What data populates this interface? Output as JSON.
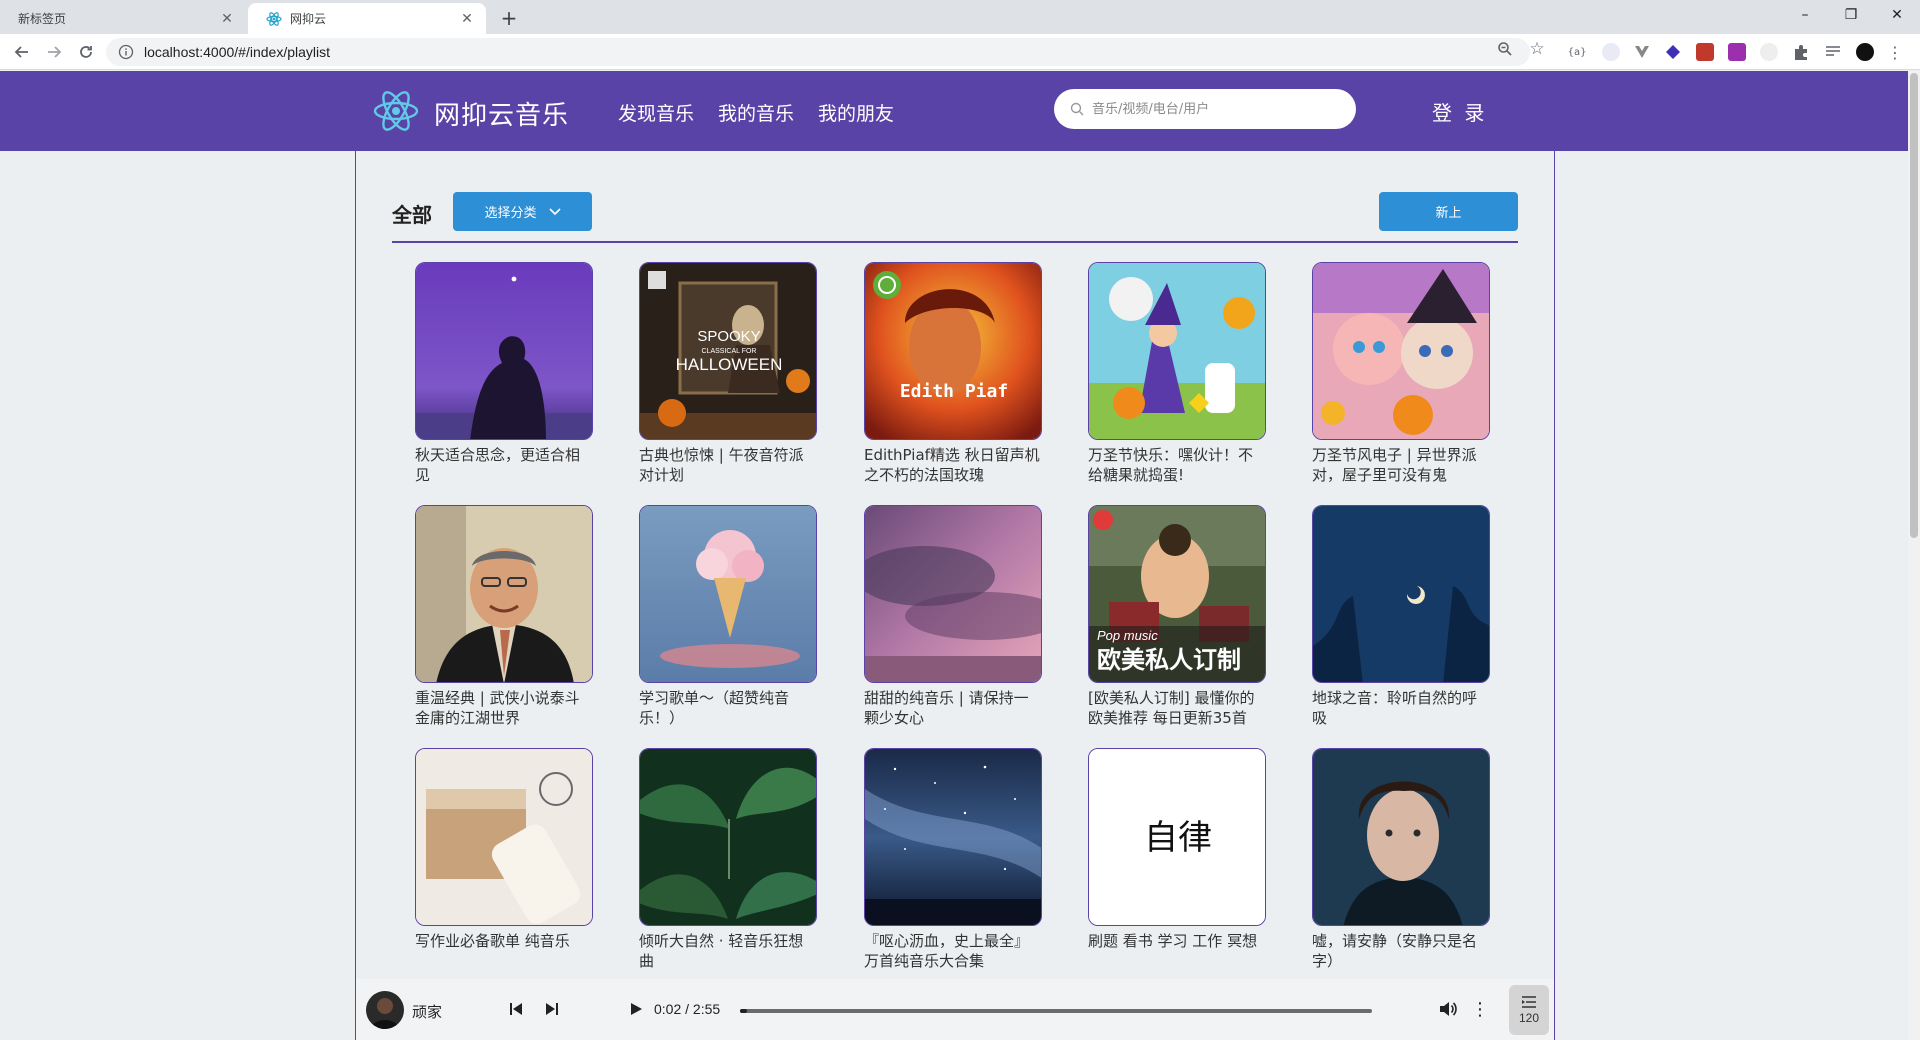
{
  "browser": {
    "tabs": [
      {
        "label": "新标签页",
        "active": false
      },
      {
        "label": "网抑云",
        "active": true
      }
    ],
    "url": "localhost:4000/#/index/playlist"
  },
  "header": {
    "logo_text": "网抑云音乐",
    "nav": [
      "发现音乐",
      "我的音乐",
      "我的朋友"
    ],
    "search_placeholder": "音乐/视频/电台/用户",
    "login_label": "登 录",
    "colors": {
      "brand": "#5a43a6",
      "accent": "#2d8fd5"
    }
  },
  "category": {
    "title": "全部",
    "select_label": "选择分类",
    "new_label": "新上"
  },
  "playlists": [
    {
      "title": "秋天适合思念，更适合相见",
      "cover": "purple-night-hoodie"
    },
    {
      "title": "古典也惊悚 | 午夜音符派对计划",
      "cover": "spooky-classical-halloween",
      "cover_text": [
        "SPOOKY",
        "CLASSICAL FOR",
        "HALLOWEEN"
      ]
    },
    {
      "title": "EdithPiaf精选 秋日留声机之不朽的法国玫瑰",
      "cover": "edith-piaf-portrait",
      "cover_text": [
        "Edith Piaf"
      ]
    },
    {
      "title": "万圣节快乐：嘿伙计！不给糖果就捣蛋!",
      "cover": "halloween-cartoon"
    },
    {
      "title": "万圣节风电子 | 异世界派对，屋子里可没有鬼",
      "cover": "anime-halloween-girls"
    },
    {
      "title": "重温经典 | 武侠小说泰斗金庸的江湖世界",
      "cover": "old-man-portrait"
    },
    {
      "title": "学习歌单～（超赞纯音乐！）",
      "cover": "cloud-ice-cream"
    },
    {
      "title": "甜甜的纯音乐 | 请保持一颗少女心",
      "cover": "pink-clouds"
    },
    {
      "title": "[欧美私人订制] 最懂你的欧美推荐 每日更新35首",
      "cover": "pop-music-drummer",
      "cover_text": [
        "Pop music",
        "欧美私人订制"
      ]
    },
    {
      "title": "地球之音：聆听自然的呼吸",
      "cover": "blue-moon-sky"
    },
    {
      "title": "写作业必备歌单 纯音乐",
      "cover": "milk-bottle-box"
    },
    {
      "title": "倾听大自然 · 轻音乐狂想曲",
      "cover": "green-monstera-leaves"
    },
    {
      "title": "『呕心沥血，史上最全』万首纯音乐大合集",
      "cover": "starry-night-sky"
    },
    {
      "title": "刷题 看书 学习 工作 冥想",
      "cover": "white-calligraphy",
      "cover_text": [
        "自律"
      ]
    },
    {
      "title": "嘘，请安静（安静只是名字）",
      "cover": "young-man-portrait"
    }
  ],
  "player": {
    "song": "顽家",
    "time": "0:02 / 2:55",
    "progress": 0.011,
    "queue_count": "120"
  }
}
